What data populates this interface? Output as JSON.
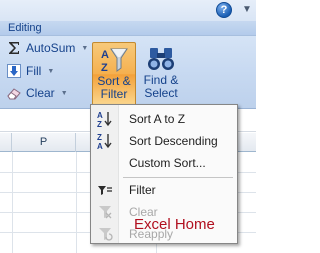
{
  "ribbon": {
    "group_title": "Editing",
    "autosum_label": "AutoSum",
    "fill_label": "Fill",
    "clear_label": "Clear",
    "sort_filter_line1": "Sort &",
    "sort_filter_line2": "Filter",
    "find_select_line1": "Find &",
    "find_select_line2": "Select",
    "help_glyph": "?",
    "more_glyph": "▼"
  },
  "sheet": {
    "column_header": "P"
  },
  "menu": {
    "items": [
      {
        "label": "Sort A to Z",
        "icon": "sort-a-to-z-icon",
        "enabled": true
      },
      {
        "label": "Sort Descending",
        "icon": "sort-descending-icon",
        "enabled": true
      },
      {
        "label": "Custom Sort...",
        "icon": "",
        "enabled": true
      },
      {
        "label": "Filter",
        "icon": "filter-icon",
        "enabled": true
      },
      {
        "label": "Clear",
        "icon": "clear-filter-icon",
        "enabled": false
      },
      {
        "label": "Reapply",
        "icon": "reapply-icon",
        "enabled": false
      }
    ]
  },
  "watermark": "Excel Home",
  "colors": {
    "accent_text": "#15428b",
    "pressed_button": "#f5b04f",
    "watermark": "#b10f1f"
  }
}
